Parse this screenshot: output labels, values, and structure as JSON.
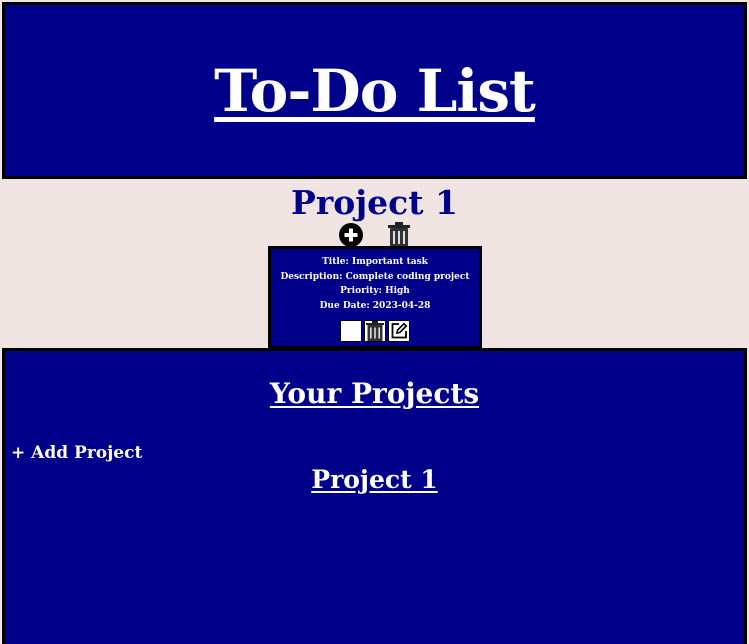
{
  "header": {
    "title": "To-Do List"
  },
  "project": {
    "title": "Project 1",
    "add_icon": "plus-circle-icon",
    "delete_icon": "trash-icon"
  },
  "task": {
    "title_line": "Title: Important task",
    "description_line": "Description: Complete coding project",
    "priority_line": "Priority: High",
    "due_line": "Due Date: 2023-04-28",
    "completed": false
  },
  "projects_panel": {
    "heading": "Your Projects",
    "add_label": "+ Add Project",
    "items": [
      {
        "label": "Project 1"
      }
    ]
  },
  "colors": {
    "primary": "#00008b",
    "background": "#f0e4e2",
    "border": "#000000",
    "text_light": "#ffffff"
  }
}
